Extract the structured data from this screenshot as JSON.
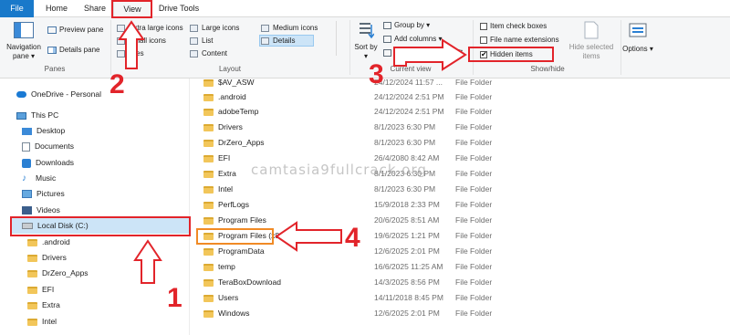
{
  "tabs": {
    "file": "File",
    "home": "Home",
    "share": "Share",
    "view": "View",
    "drive_tools": "Drive Tools"
  },
  "ribbon": {
    "panes": {
      "navigation_pane": "Navigation pane ▾",
      "preview_pane": "Preview pane",
      "details_pane": "Details pane",
      "group_label": "Panes"
    },
    "layout": {
      "extra_large_icons": "Extra large icons",
      "large_icons": "Large icons",
      "medium_icons": "Medium icons",
      "small_icons": "Small icons",
      "list": "List",
      "details": "Details",
      "tiles": "Tiles",
      "content": "Content",
      "group_label": "Layout"
    },
    "current_view": {
      "sort_by": "Sort by ▾",
      "group_by": "Group by ▾",
      "add_columns": "Add columns ▾",
      "size_all_columns": "Size all columns to fit",
      "group_label": "Current view"
    },
    "show_hide": {
      "item_check_boxes": "Item check boxes",
      "item_check_boxes_checked": false,
      "file_name_extensions": "File name extensions",
      "file_name_extensions_checked": false,
      "hidden_items": "Hidden items",
      "hidden_items_checked": true,
      "hide_selected_items": "Hide selected items",
      "group_label": "Show/hide"
    },
    "options": "Options ▾"
  },
  "nav": {
    "items": [
      {
        "label": "OneDrive - Personal",
        "icon": "cloud-icon"
      },
      {
        "label": "This PC",
        "icon": "computer-icon"
      },
      {
        "label": "Desktop",
        "icon": "desktop-icon"
      },
      {
        "label": "Documents",
        "icon": "documents-icon"
      },
      {
        "label": "Downloads",
        "icon": "downloads-icon"
      },
      {
        "label": "Music",
        "icon": "music-icon"
      },
      {
        "label": "Pictures",
        "icon": "pictures-icon"
      },
      {
        "label": "Videos",
        "icon": "videos-icon"
      },
      {
        "label": "Local Disk (C:)",
        "icon": "disk-icon"
      },
      {
        "label": ".android",
        "icon": "folder-icon"
      },
      {
        "label": "Drivers",
        "icon": "folder-icon"
      },
      {
        "label": "DrZero_Apps",
        "icon": "folder-icon"
      },
      {
        "label": "EFI",
        "icon": "folder-icon"
      },
      {
        "label": "Extra",
        "icon": "folder-icon"
      },
      {
        "label": "Intel",
        "icon": "folder-icon"
      }
    ]
  },
  "files": [
    {
      "name": "$AV_ASW",
      "date": "24/12/2024 11:57 ...",
      "type": "File Folder"
    },
    {
      "name": ".android",
      "date": "24/12/2024 2:51 PM",
      "type": "File Folder"
    },
    {
      "name": "adobeTemp",
      "date": "24/12/2024 2:51 PM",
      "type": "File Folder"
    },
    {
      "name": "Drivers",
      "date": "8/1/2023 6:30 PM",
      "type": "File Folder"
    },
    {
      "name": "DrZero_Apps",
      "date": "8/1/2023 6:30 PM",
      "type": "File Folder"
    },
    {
      "name": "EFI",
      "date": "26/4/2080 8:42 AM",
      "type": "File Folder"
    },
    {
      "name": "Extra",
      "date": "8/1/2023 6:30 PM",
      "type": "File Folder"
    },
    {
      "name": "Intel",
      "date": "8/1/2023 6:30 PM",
      "type": "File Folder"
    },
    {
      "name": "PerfLogs",
      "date": "15/9/2018 2:33 PM",
      "type": "File Folder"
    },
    {
      "name": "Program Files",
      "date": "20/6/2025 8:51 AM",
      "type": "File Folder"
    },
    {
      "name": "Program Files (x86)",
      "date": "19/6/2025 1:21 PM",
      "type": "File Folder"
    },
    {
      "name": "ProgramData",
      "date": "12/6/2025 2:01 PM",
      "type": "File Folder"
    },
    {
      "name": "temp",
      "date": "16/6/2025 11:25 AM",
      "type": "File Folder"
    },
    {
      "name": "TeraBoxDownload",
      "date": "14/3/2025 8:56 PM",
      "type": "File Folder"
    },
    {
      "name": "Users",
      "date": "14/11/2018 8:45 PM",
      "type": "File Folder"
    },
    {
      "name": "Windows",
      "date": "12/6/2025 2:01 PM",
      "type": "File Folder"
    }
  ],
  "watermark": "camtasia9fullcrack.org",
  "annotations": {
    "step1": "1",
    "step2": "2",
    "step3": "3",
    "step4": "4",
    "color_red": "#e2242a",
    "color_orange": "#f08a25"
  }
}
